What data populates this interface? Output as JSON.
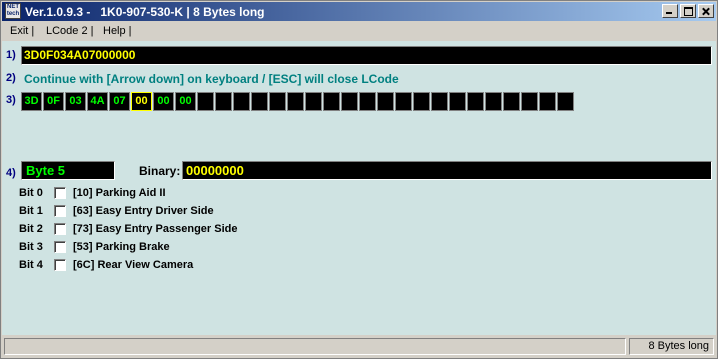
{
  "window": {
    "title": "Ver.1.0.9.3 -   1K0-907-530-K | 8 Bytes long",
    "icon_text": "NET tech"
  },
  "menu": {
    "items": [
      "Exit |",
      "LCode 2 |",
      "Help |"
    ]
  },
  "main": {
    "row1_num": "1)",
    "hex_string": "3D0F034A07000000",
    "row2_num": "2)",
    "message": "Continue with [Arrow down] on keyboard / [ESC] will close LCode",
    "row3_num": "3)",
    "bytes": [
      "3D",
      "0F",
      "03",
      "4A",
      "07",
      "00",
      "00",
      "00"
    ],
    "selected_byte_index": 5,
    "empty_cell_count": 21,
    "row4_num": "4)",
    "byte_label": "Byte 5",
    "binary_label": "Binary:",
    "binary_value": "00000000",
    "bits": [
      {
        "name": "Bit 0",
        "checked": false,
        "desc": "[10] Parking Aid II"
      },
      {
        "name": "Bit 1",
        "checked": false,
        "desc": "[63] Easy Entry Driver Side"
      },
      {
        "name": "Bit 2",
        "checked": false,
        "desc": "[73] Easy Entry Passenger Side"
      },
      {
        "name": "Bit 3",
        "checked": false,
        "desc": "[53] Parking Brake"
      },
      {
        "name": "Bit 4",
        "checked": false,
        "desc": "[6C] Rear View Camera"
      }
    ]
  },
  "status": {
    "left": "",
    "right": "8 Bytes long"
  },
  "colors": {
    "client_bg": "#cfe3e2",
    "field_bg": "#000000",
    "hex_text": "#ffff00",
    "byte_text": "#00ff00",
    "message": "#008080",
    "row_number": "#000080"
  },
  "icons": [
    "app-icon",
    "minimize-icon",
    "maximize-icon",
    "close-icon"
  ]
}
